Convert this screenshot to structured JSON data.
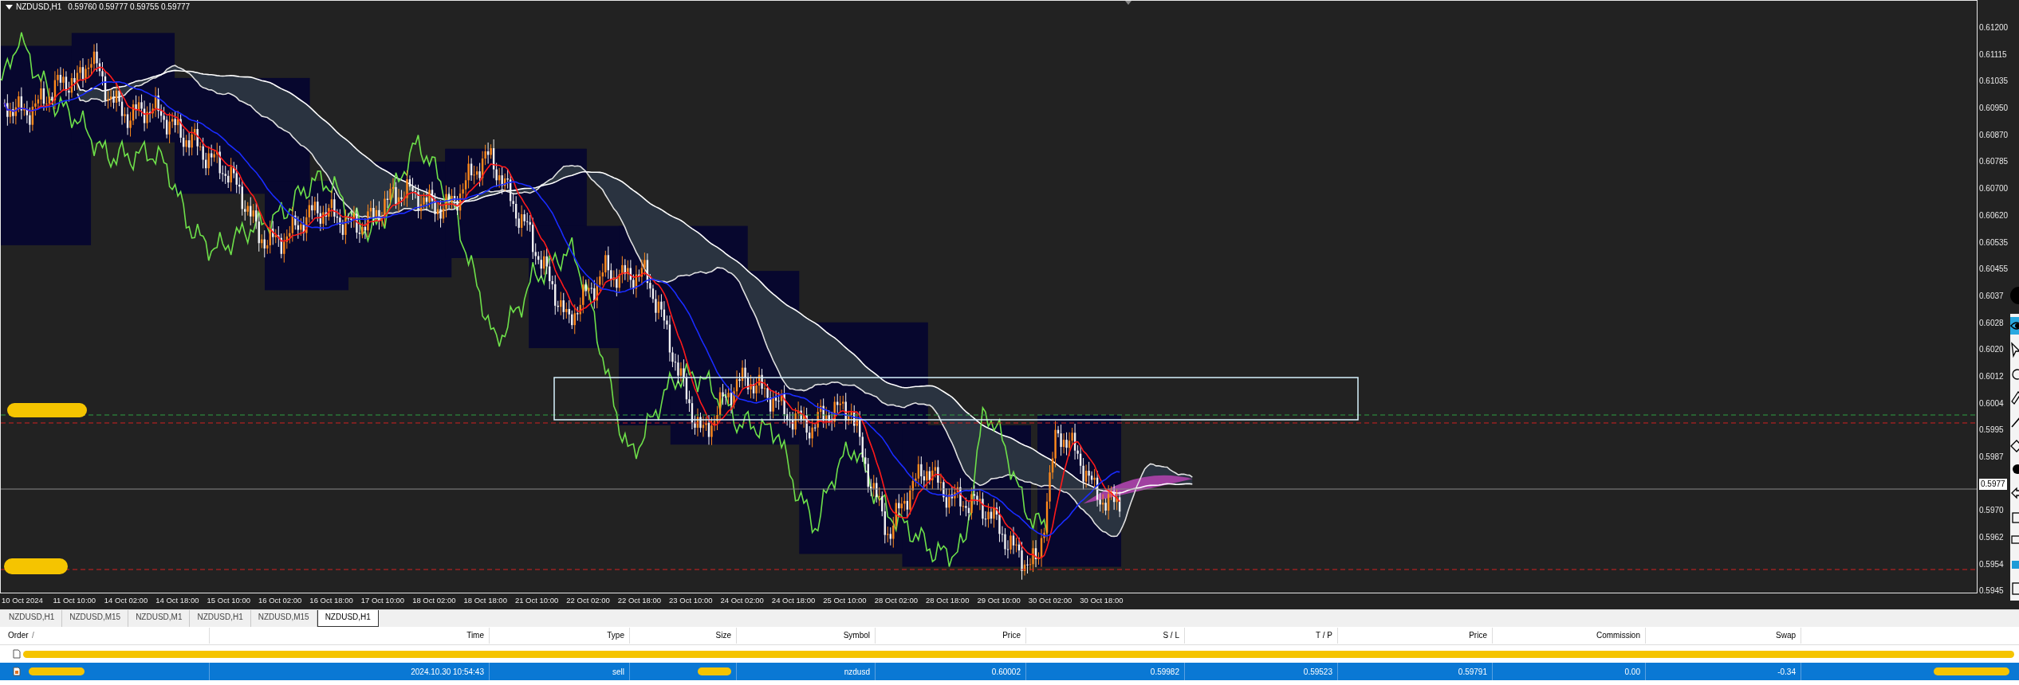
{
  "chart": {
    "symbol": "NZDUSD,H1",
    "ohlc": "0.59760 0.59777 0.59755 0.59777"
  },
  "price_axis": {
    "labels": [
      {
        "kind": "tick",
        "text": "0.61200"
      },
      {
        "kind": "tick",
        "text": "0.61115"
      },
      {
        "kind": "tick",
        "text": "0.61035"
      },
      {
        "kind": "tick",
        "text": "0.60950"
      },
      {
        "kind": "tick",
        "text": "0.60870"
      },
      {
        "kind": "tick",
        "text": "0.60785"
      },
      {
        "kind": "tick",
        "text": "0.60700"
      },
      {
        "kind": "tick",
        "text": "0.60620"
      },
      {
        "kind": "tick",
        "text": "0.60535"
      },
      {
        "kind": "tick",
        "text": "0.60455"
      },
      {
        "kind": "tick",
        "text": "0.6037"
      },
      {
        "kind": "tick",
        "text": "0.6028"
      },
      {
        "kind": "tick",
        "text": "0.6020"
      },
      {
        "kind": "tick",
        "text": "0.6012"
      },
      {
        "kind": "tick",
        "text": "0.6004"
      },
      {
        "kind": "tick",
        "text": "0.5995"
      },
      {
        "kind": "tick",
        "text": "0.5987"
      },
      {
        "kind": "current",
        "text": "0.5977"
      },
      {
        "kind": "tick",
        "text": "0.5970"
      },
      {
        "kind": "tick",
        "text": "0.5962"
      },
      {
        "kind": "tick",
        "text": "0.5954"
      },
      {
        "kind": "tick",
        "text": "0.5945"
      }
    ]
  },
  "time_axis": {
    "labels": [
      "10 Oct 2024",
      "11 Oct 10:00",
      "14 Oct 02:00",
      "14 Oct 18:00",
      "15 Oct 10:00",
      "16 Oct 02:00",
      "16 Oct 18:00",
      "17 Oct 10:00",
      "18 Oct 02:00",
      "18 Oct 18:00",
      "21 Oct 10:00",
      "22 Oct 02:00",
      "22 Oct 18:00",
      "23 Oct 10:00",
      "24 Oct 02:00",
      "24 Oct 18:00",
      "25 Oct 10:00",
      "28 Oct 02:00",
      "28 Oct 18:00",
      "29 Oct 10:00",
      "30 Oct 02:00",
      "30 Oct 18:00"
    ]
  },
  "toolbar": {
    "items": [
      {
        "kind": "eye",
        "selected": true
      },
      {
        "kind": "cursor",
        "selected": false
      },
      {
        "kind": "alarm",
        "selected": false
      },
      {
        "kind": "pencil",
        "selected": false
      },
      {
        "kind": "line",
        "selected": false
      },
      {
        "kind": "ruler",
        "selected": false
      },
      {
        "kind": "dot",
        "selected": false
      },
      {
        "kind": "arrow",
        "selected": false
      },
      {
        "kind": "trash",
        "selected": false
      },
      {
        "kind": "screen",
        "selected": false
      },
      {
        "kind": "camera",
        "selected": false
      },
      {
        "kind": "clipboard",
        "selected": false
      }
    ]
  },
  "tabs": [
    {
      "label": "NZDUSD,H1",
      "selected": false
    },
    {
      "label": "NZDUSD,M15",
      "selected": false
    },
    {
      "label": "NZDUSD,M1",
      "selected": false
    },
    {
      "label": "NZDUSD,H1",
      "selected": false
    },
    {
      "label": "NZDUSD,M15",
      "selected": false
    },
    {
      "label": "NZDUSD,H1",
      "selected": true
    }
  ],
  "table": {
    "columns": [
      "Order",
      "Time",
      "Type",
      "Size",
      "Symbol",
      "Price",
      "S / L",
      "T / P",
      "Price",
      "Commission",
      "Swap"
    ],
    "sort_indicator": "/",
    "rows": [
      {
        "kind": "redacted",
        "selected": false
      },
      {
        "kind": "order",
        "selected": true,
        "time": "2024.10.30 10:54:43",
        "type": "sell",
        "symbol": "nzdusd",
        "price": "0.60002",
        "sl": "0.59982",
        "tp": "0.59523",
        "current_price": "0.59791",
        "commission": "0.00",
        "swap": "-0.34"
      }
    ]
  }
}
